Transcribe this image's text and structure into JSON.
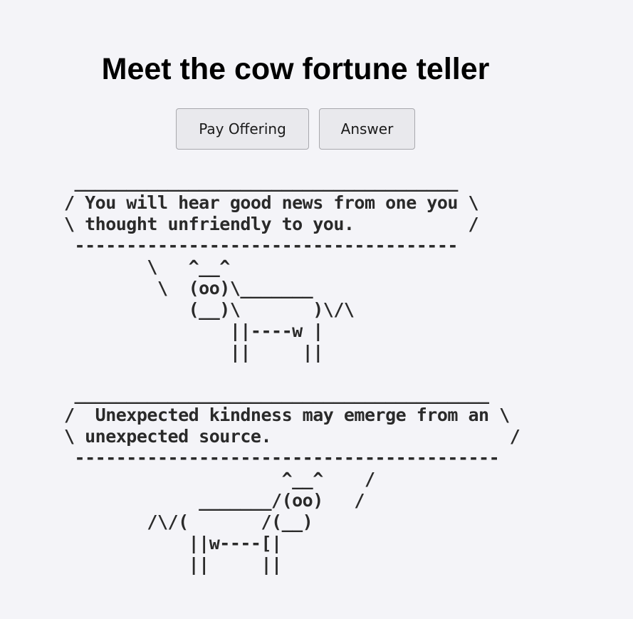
{
  "header": {
    "title": "Meet the cow fortune teller"
  },
  "buttons": {
    "pay_offering": "Pay Offering",
    "answer": "Answer"
  },
  "fortunes": [
    {
      "text": " _____________________________________\n/ You will hear good news from one you \\\n\\ thought unfriendly to you.           /\n -------------------------------------\n        \\   ^__^\n         \\  (oo)\\_______\n            (__)\\       )\\/\\\n                ||----w |\n                ||     ||"
    },
    {
      "text": " ________________________________________\n/  Unexpected kindness may emerge from an \\\n\\ unexpected source.                       /\n -----------------------------------------\n                     ^__^    /\n             _______/(oo)   /\n        /\\/(       /(__)\n            ||w----[|\n            ||     ||"
    }
  ]
}
